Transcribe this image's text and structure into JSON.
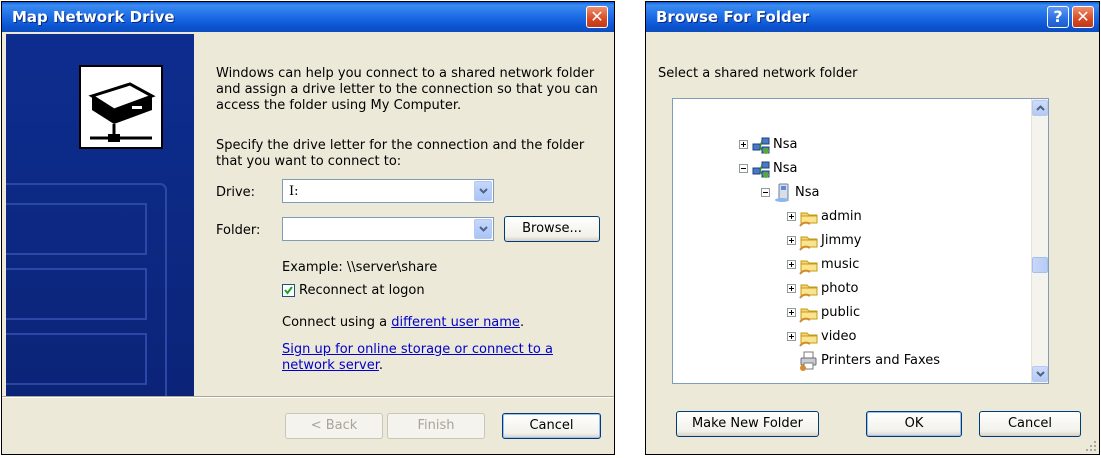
{
  "map_dialog": {
    "title": "Map Network Drive",
    "intro": "Windows can help you connect to a shared network folder and assign a drive letter to the connection so that you can access the folder using My Computer.",
    "instruction": "Specify the drive letter for the connection and the folder that you want to connect to:",
    "drive_label": "Drive:",
    "drive_value": "I:",
    "folder_label": "Folder:",
    "folder_value": "",
    "browse_label": "Browse...",
    "example": "Example: \\\\server\\share",
    "reconnect_label": "Reconnect at logon",
    "reconnect_checked": true,
    "connect_prefix": "Connect using a ",
    "connect_link": "different user name",
    "connect_suffix": ".",
    "signup_link": "Sign up for online storage or connect to a network server",
    "signup_suffix": ".",
    "back_label": "< Back",
    "finish_label": "Finish",
    "cancel_label": "Cancel"
  },
  "browse_dialog": {
    "title": "Browse For Folder",
    "prompt": "Select a shared network folder",
    "tree": [
      {
        "label": "Nsa",
        "level": 0,
        "expander": "plus",
        "icon": "network-workgroup-icon"
      },
      {
        "label": "Nsa",
        "level": 0,
        "expander": "minus",
        "icon": "network-workgroup-icon"
      },
      {
        "label": "Nsa",
        "level": 1,
        "expander": "minus",
        "icon": "computer-icon"
      },
      {
        "label": "admin",
        "level": 2,
        "expander": "plus",
        "icon": "shared-folder-icon"
      },
      {
        "label": "Jimmy",
        "level": 2,
        "expander": "plus",
        "icon": "shared-folder-icon"
      },
      {
        "label": "music",
        "level": 2,
        "expander": "plus",
        "icon": "shared-folder-icon"
      },
      {
        "label": "photo",
        "level": 2,
        "expander": "plus",
        "icon": "shared-folder-icon"
      },
      {
        "label": "public",
        "level": 2,
        "expander": "plus",
        "icon": "shared-folder-icon"
      },
      {
        "label": "video",
        "level": 2,
        "expander": "plus",
        "icon": "shared-folder-icon"
      },
      {
        "label": "Printers and Faxes",
        "level": 2,
        "expander": "none",
        "icon": "printer-icon"
      }
    ],
    "make_folder_label": "Make New Folder",
    "ok_label": "OK",
    "cancel_label": "Cancel"
  },
  "colors": {
    "titlebar_blue": "#0b55d2",
    "side_panel_blue": "#0c2a8a",
    "dialog_bg": "#ece9d8",
    "link": "#0000cc"
  }
}
